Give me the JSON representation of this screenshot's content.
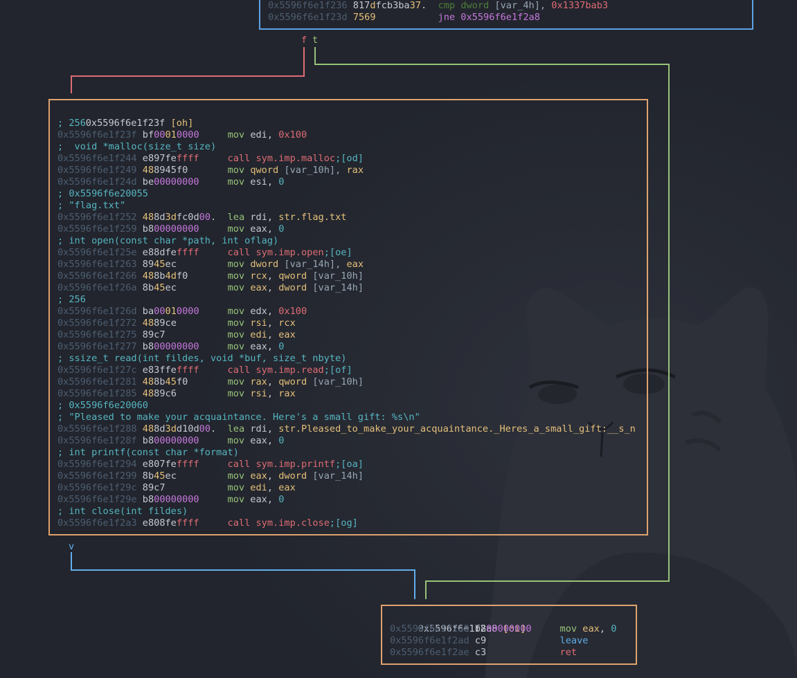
{
  "top_block": {
    "lines": [
      {
        "addr": "0x5596f6e1f236",
        "bytes": [
          [
            "817",
            "n"
          ],
          [
            "d",
            "y"
          ],
          [
            "fcb3ba",
            "n"
          ],
          [
            "37",
            "y"
          ],
          [
            ".",
            "n"
          ]
        ],
        "mn": "cmp",
        "mn_style": "dg",
        "ops": [
          [
            "dword",
            "dg"
          ],
          [
            " [var_4h], ",
            "g"
          ],
          [
            "0x1337bab3",
            "r"
          ]
        ]
      },
      {
        "addr": "0x5596f6e1f23d",
        "bytes": [
          [
            "7569",
            "y"
          ]
        ],
        "mn": "jne",
        "mn_style": "p",
        "ops": [
          [
            "0x5596f6e1f2a8",
            "p"
          ]
        ]
      }
    ]
  },
  "edge_labels": {
    "false_label": "f",
    "true_label": "t",
    "jump_label": "v"
  },
  "main_block": {
    "header_addr": "0x5596f6e1f23f",
    "header_tag": "[oh]",
    "lines": [
      {
        "comment": "; 256"
      },
      {
        "addr": "0x5596f6e1f23f",
        "bytes": [
          [
            "bf",
            "n"
          ],
          [
            "00",
            "p"
          ],
          [
            "01",
            "y"
          ],
          [
            "0000",
            "p"
          ]
        ],
        "mn": "mov",
        "mn_style": "g",
        "ops": [
          [
            "edi",
            "n"
          ],
          [
            ", ",
            "n"
          ],
          [
            "0x100",
            "r"
          ]
        ]
      },
      {
        "comment": ";  void *malloc(size_t size)"
      },
      {
        "addr": "0x5596f6e1f244",
        "bytes": [
          [
            "e897fe",
            "n"
          ],
          [
            "ffff",
            "r"
          ]
        ],
        "mn": "call",
        "mn_style": "r",
        "ops": [
          [
            "sym.imp.malloc",
            "r"
          ],
          [
            ";[od]",
            "c"
          ]
        ]
      },
      {
        "addr": "0x5596f6e1f249",
        "bytes": [
          [
            "48",
            "y"
          ],
          [
            "8945",
            "n"
          ],
          [
            "f0",
            "n"
          ]
        ],
        "mn": "mov",
        "mn_style": "g",
        "ops": [
          [
            "qword",
            "y"
          ],
          [
            " [var_10h], ",
            "g"
          ],
          [
            "rax",
            "y"
          ]
        ]
      },
      {
        "addr": "0x5596f6e1f24d",
        "bytes": [
          [
            "be",
            "n"
          ],
          [
            "00000000",
            "p"
          ]
        ],
        "mn": "mov",
        "mn_style": "g",
        "ops": [
          [
            "esi",
            "n"
          ],
          [
            ", ",
            "n"
          ],
          [
            "0",
            "c"
          ]
        ]
      },
      {
        "comment": "; 0x5596f6e20055"
      },
      {
        "comment": "; \"flag.txt\""
      },
      {
        "addr": "0x5596f6e1f252",
        "bytes": [
          [
            "48",
            "y"
          ],
          [
            "8d",
            "n"
          ],
          [
            "3d",
            "y"
          ],
          [
            "fc0d",
            "n"
          ],
          [
            "00",
            "p"
          ],
          [
            ".",
            "n"
          ]
        ],
        "mn": "lea",
        "mn_style": "g",
        "ops": [
          [
            "rdi",
            "n"
          ],
          [
            ", ",
            "n"
          ],
          [
            "str.flag.txt",
            "y"
          ]
        ]
      },
      {
        "addr": "0x5596f6e1f259",
        "bytes": [
          [
            "b8",
            "n"
          ],
          [
            "00000000",
            "p"
          ]
        ],
        "mn": "mov",
        "mn_style": "g",
        "ops": [
          [
            "eax",
            "n"
          ],
          [
            ", ",
            "n"
          ],
          [
            "0",
            "c"
          ]
        ]
      },
      {
        "comment": "; int open(const char *path, int oflag)"
      },
      {
        "addr": "0x5596f6e1f25e",
        "bytes": [
          [
            "e88dfe",
            "n"
          ],
          [
            "ffff",
            "r"
          ]
        ],
        "mn": "call",
        "mn_style": "r",
        "ops": [
          [
            "sym.imp.open",
            "r"
          ],
          [
            ";[oe]",
            "c"
          ]
        ]
      },
      {
        "addr": "0x5596f6e1f263",
        "bytes": [
          [
            "89",
            "n"
          ],
          [
            "45",
            "y"
          ],
          [
            "ec",
            "n"
          ]
        ],
        "mn": "mov",
        "mn_style": "g",
        "ops": [
          [
            "dword",
            "y"
          ],
          [
            " [var_14h], ",
            "g"
          ],
          [
            "eax",
            "y"
          ]
        ]
      },
      {
        "addr": "0x5596f6e1f266",
        "bytes": [
          [
            "48",
            "y"
          ],
          [
            "8b",
            "n"
          ],
          [
            "4d",
            "y"
          ],
          [
            "f0",
            "n"
          ]
        ],
        "mn": "mov",
        "mn_style": "g",
        "ops": [
          [
            "rcx",
            "y"
          ],
          [
            ", ",
            "n"
          ],
          [
            "qword",
            "y"
          ],
          [
            " [var_10h]",
            "g"
          ]
        ]
      },
      {
        "addr": "0x5596f6e1f26a",
        "bytes": [
          [
            "8b",
            "n"
          ],
          [
            "45",
            "y"
          ],
          [
            "ec",
            "n"
          ]
        ],
        "mn": "mov",
        "mn_style": "g",
        "ops": [
          [
            "eax",
            "y"
          ],
          [
            ", ",
            "n"
          ],
          [
            "dword",
            "y"
          ],
          [
            " [var_14h]",
            "g"
          ]
        ]
      },
      {
        "comment": "; 256"
      },
      {
        "addr": "0x5596f6e1f26d",
        "bytes": [
          [
            "ba",
            "n"
          ],
          [
            "00",
            "p"
          ],
          [
            "01",
            "y"
          ],
          [
            "0000",
            "p"
          ]
        ],
        "mn": "mov",
        "mn_style": "g",
        "ops": [
          [
            "edx",
            "n"
          ],
          [
            ", ",
            "n"
          ],
          [
            "0x100",
            "r"
          ]
        ]
      },
      {
        "addr": "0x5596f6e1f272",
        "bytes": [
          [
            "48",
            "y"
          ],
          [
            "89ce",
            "n"
          ]
        ],
        "mn": "mov",
        "mn_style": "g",
        "ops": [
          [
            "rsi",
            "y"
          ],
          [
            ", ",
            "n"
          ],
          [
            "rcx",
            "y"
          ]
        ]
      },
      {
        "addr": "0x5596f6e1f275",
        "bytes": [
          [
            "89c7",
            "n"
          ]
        ],
        "mn": "mov",
        "mn_style": "g",
        "ops": [
          [
            "edi",
            "y"
          ],
          [
            ", ",
            "n"
          ],
          [
            "eax",
            "y"
          ]
        ]
      },
      {
        "addr": "0x5596f6e1f277",
        "bytes": [
          [
            "b8",
            "n"
          ],
          [
            "00000000",
            "p"
          ]
        ],
        "mn": "mov",
        "mn_style": "g",
        "ops": [
          [
            "eax",
            "n"
          ],
          [
            ", ",
            "n"
          ],
          [
            "0",
            "c"
          ]
        ]
      },
      {
        "comment": "; ssize_t read(int fildes, void *buf, size_t nbyte)"
      },
      {
        "addr": "0x5596f6e1f27c",
        "bytes": [
          [
            "e83ffe",
            "n"
          ],
          [
            "ffff",
            "r"
          ]
        ],
        "mn": "call",
        "mn_style": "r",
        "ops": [
          [
            "sym.imp.read",
            "r"
          ],
          [
            ";[of]",
            "c"
          ]
        ]
      },
      {
        "addr": "0x5596f6e1f281",
        "bytes": [
          [
            "48",
            "y"
          ],
          [
            "8b",
            "n"
          ],
          [
            "45",
            "y"
          ],
          [
            "f0",
            "n"
          ]
        ],
        "mn": "mov",
        "mn_style": "g",
        "ops": [
          [
            "rax",
            "y"
          ],
          [
            ", ",
            "n"
          ],
          [
            "qword",
            "y"
          ],
          [
            " [var_10h]",
            "g"
          ]
        ]
      },
      {
        "addr": "0x5596f6e1f285",
        "bytes": [
          [
            "48",
            "y"
          ],
          [
            "89c6",
            "n"
          ]
        ],
        "mn": "mov",
        "mn_style": "g",
        "ops": [
          [
            "rsi",
            "y"
          ],
          [
            ", ",
            "n"
          ],
          [
            "rax",
            "y"
          ]
        ]
      },
      {
        "comment": "; 0x5596f6e20060"
      },
      {
        "comment": "; \"Pleased to make your acquaintance. Here's a small gift: %s\\n\""
      },
      {
        "addr": "0x5596f6e1f288",
        "bytes": [
          [
            "48",
            "y"
          ],
          [
            "8d",
            "n"
          ],
          [
            "3d",
            "y"
          ],
          [
            "d10d",
            "n"
          ],
          [
            "00",
            "p"
          ],
          [
            ".",
            "n"
          ]
        ],
        "mn": "lea",
        "mn_style": "g",
        "ops": [
          [
            "rdi",
            "n"
          ],
          [
            ", ",
            "n"
          ],
          [
            "str.Pleased_to_make_your_acquaintance._Heres_a_small_gift:__s_n",
            "y"
          ]
        ]
      },
      {
        "addr": "0x5596f6e1f28f",
        "bytes": [
          [
            "b8",
            "n"
          ],
          [
            "00000000",
            "p"
          ]
        ],
        "mn": "mov",
        "mn_style": "g",
        "ops": [
          [
            "eax",
            "n"
          ],
          [
            ", ",
            "n"
          ],
          [
            "0",
            "c"
          ]
        ]
      },
      {
        "comment": "; int printf(const char *format)"
      },
      {
        "addr": "0x5596f6e1f294",
        "bytes": [
          [
            "e807fe",
            "n"
          ],
          [
            "ffff",
            "r"
          ]
        ],
        "mn": "call",
        "mn_style": "r",
        "ops": [
          [
            "sym.imp.printf",
            "r"
          ],
          [
            ";[oa]",
            "c"
          ]
        ]
      },
      {
        "addr": "0x5596f6e1f299",
        "bytes": [
          [
            "8b",
            "n"
          ],
          [
            "45",
            "y"
          ],
          [
            "ec",
            "n"
          ]
        ],
        "mn": "mov",
        "mn_style": "g",
        "ops": [
          [
            "eax",
            "y"
          ],
          [
            ", ",
            "n"
          ],
          [
            "dword",
            "y"
          ],
          [
            " [var_14h]",
            "g"
          ]
        ]
      },
      {
        "addr": "0x5596f6e1f29c",
        "bytes": [
          [
            "89c7",
            "n"
          ]
        ],
        "mn": "mov",
        "mn_style": "g",
        "ops": [
          [
            "edi",
            "y"
          ],
          [
            ", ",
            "n"
          ],
          [
            "eax",
            "y"
          ]
        ]
      },
      {
        "addr": "0x5596f6e1f29e",
        "bytes": [
          [
            "b8",
            "n"
          ],
          [
            "00000000",
            "p"
          ]
        ],
        "mn": "mov",
        "mn_style": "g",
        "ops": [
          [
            "eax",
            "n"
          ],
          [
            ", ",
            "n"
          ],
          [
            "0",
            "c"
          ]
        ]
      },
      {
        "comment": "; int close(int fildes)"
      },
      {
        "addr": "0x5596f6e1f2a3",
        "bytes": [
          [
            "e808fe",
            "n"
          ],
          [
            "ffff",
            "r"
          ]
        ],
        "mn": "call",
        "mn_style": "r",
        "ops": [
          [
            "sym.imp.close",
            "r"
          ],
          [
            ";[og]",
            "c"
          ]
        ]
      }
    ]
  },
  "ret_block": {
    "header_addr": "0x5596f6e1f2a8",
    "header_tag": "[oi]",
    "lines": [
      {
        "addr": "0x5596f6e1f2a8",
        "bytes": [
          [
            "b8",
            "n"
          ],
          [
            "00000000",
            "p"
          ]
        ],
        "mn": "mov",
        "mn_style": "g",
        "ops": [
          [
            "eax",
            "y"
          ],
          [
            ", ",
            "n"
          ],
          [
            "0",
            "c"
          ]
        ]
      },
      {
        "addr": "0x5596f6e1f2ad",
        "bytes": [
          [
            "c9",
            "n"
          ]
        ],
        "mn": "leave",
        "mn_style": "b",
        "ops": []
      },
      {
        "addr": "0x5596f6e1f2ae",
        "bytes": [
          [
            "c3",
            "n"
          ]
        ],
        "mn": "ret",
        "mn_style": "r",
        "ops": []
      }
    ]
  },
  "colors": {
    "background": "#22252d",
    "block_border_blue": "#5da4e6",
    "block_border_orange": "#e0a36f",
    "edge_false": "#e06c75",
    "edge_true": "#98c379",
    "edge_jump": "#61afef"
  },
  "background_art": "cat-figurine-photo"
}
